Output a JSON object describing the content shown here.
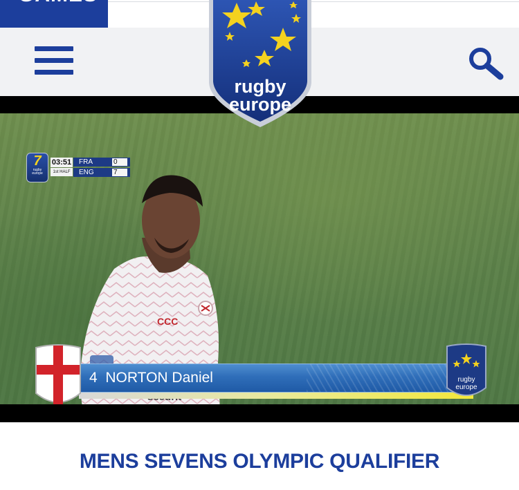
{
  "nav": {
    "games_label": "GAMES",
    "menu_icon": "hamburger-menu-icon",
    "search_icon": "search-icon"
  },
  "logo": {
    "line1": "rugby",
    "line2": "europe"
  },
  "video": {
    "scorebug": {
      "badge_number": "7",
      "badge_text_1": "rugby",
      "badge_text_2": "europe",
      "clock": "03:51",
      "period": "1st HALF",
      "home_team": "FRA",
      "home_score": "0",
      "away_team": "ENG",
      "away_score": "7"
    },
    "caption": {
      "player_number": "4",
      "player_name": "NORTON Daniel",
      "logo_line1": "rugby",
      "logo_line2": "europe"
    },
    "shirt_sponsor": "securit",
    "shirt_brand": "CCC"
  },
  "article": {
    "headline": "MENS SEVENS OLYMPIC QUALIFIER"
  },
  "colors": {
    "brand_blue": "#1c3e9c",
    "star_yellow": "#f4d21f",
    "header_bg": "#f1f2f4"
  }
}
